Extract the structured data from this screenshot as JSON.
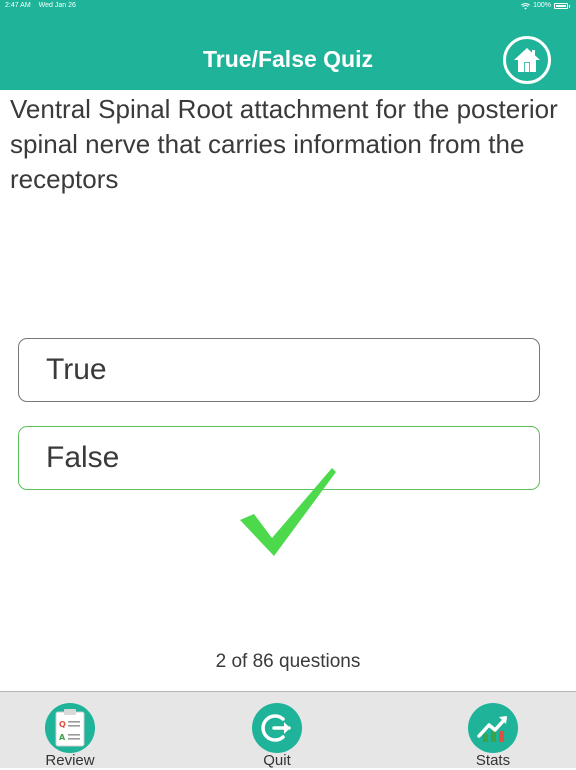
{
  "status_bar": {
    "time": "2:47 AM",
    "date": "Wed Jan 26",
    "battery": "100%",
    "wifi_icon": "wifi-icon",
    "battery_icon": "battery-icon"
  },
  "header": {
    "title": "True/False Quiz",
    "home_icon": "home-icon",
    "background_color": "#1fb39a"
  },
  "question": {
    "text": "Ventral Spinal Root attachment for the posterior spinal nerve that carries information from the receptors"
  },
  "answers": [
    {
      "label": "True",
      "state": "default"
    },
    {
      "label": "False",
      "state": "correct"
    }
  ],
  "feedback": {
    "icon": "checkmark-icon",
    "color": "#4cd94c"
  },
  "progress": {
    "text": "2 of 86 questions"
  },
  "tabbar": {
    "items": [
      {
        "label": "Review",
        "icon": "review-icon"
      },
      {
        "label": "Quit",
        "icon": "quit-icon"
      },
      {
        "label": "Stats",
        "icon": "stats-icon"
      }
    ]
  }
}
